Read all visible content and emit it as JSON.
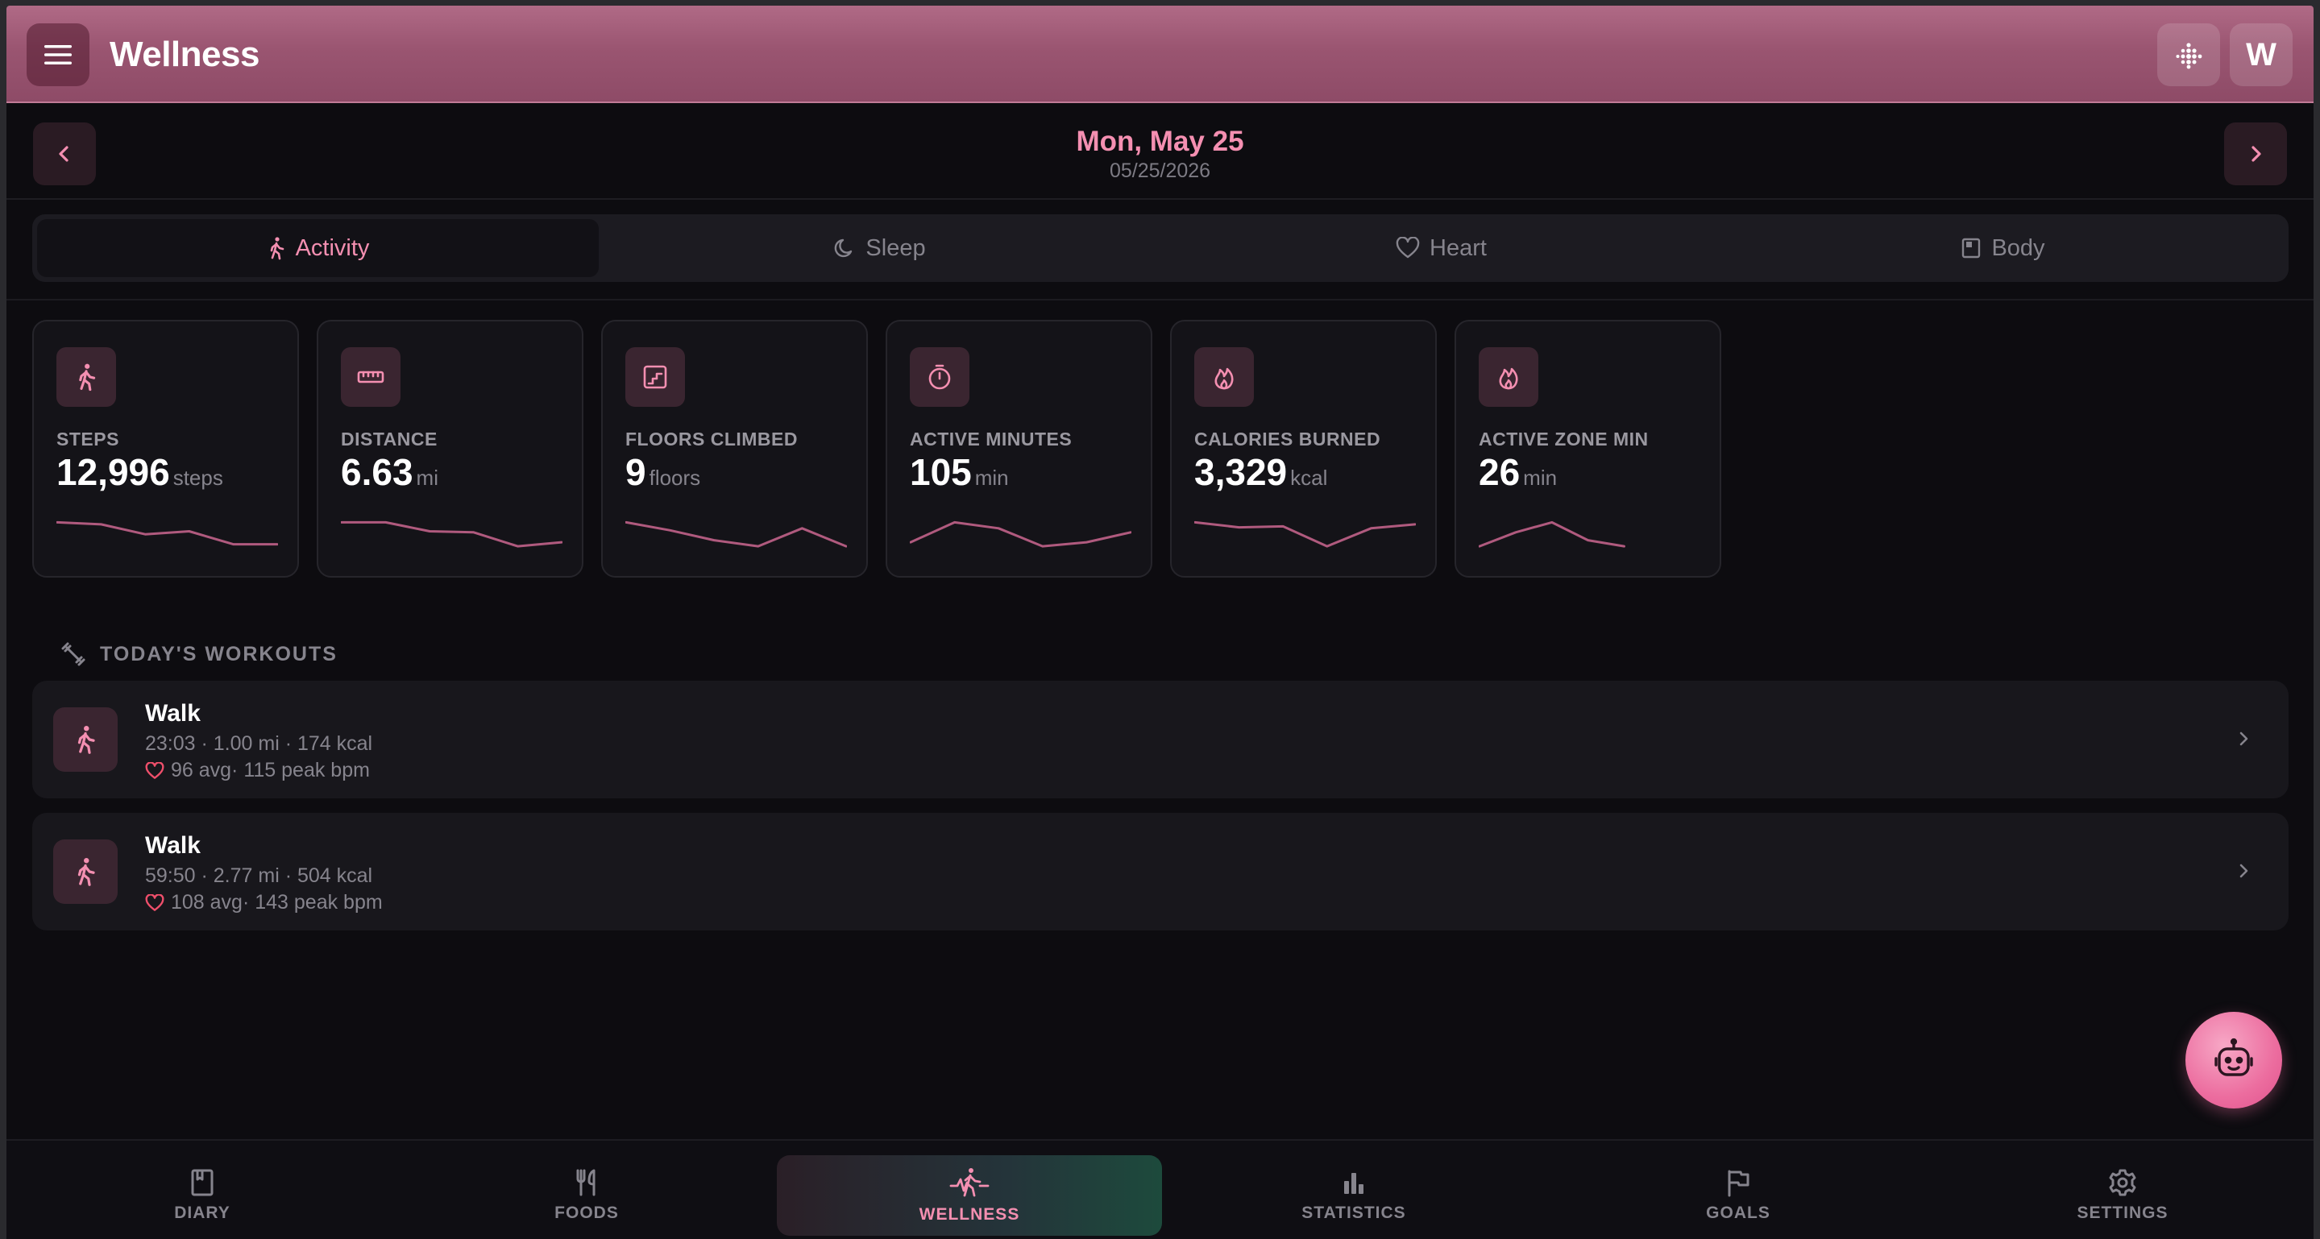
{
  "header": {
    "title": "Wellness",
    "avatar_letter": "W"
  },
  "date": {
    "main": "Mon, May 25",
    "sub": "05/25/2026"
  },
  "tabs": [
    {
      "label": "Activity",
      "icon": "walk-icon",
      "active": true
    },
    {
      "label": "Sleep",
      "icon": "moon-icon",
      "active": false
    },
    {
      "label": "Heart",
      "icon": "heart-icon",
      "active": false
    },
    {
      "label": "Body",
      "icon": "body-icon",
      "active": false
    }
  ],
  "metrics": [
    {
      "label": "STEPS",
      "value": "12,996",
      "unit": "steps",
      "icon": "walk-icon",
      "trend": [
        6,
        8,
        18,
        15,
        28,
        28
      ]
    },
    {
      "label": "DISTANCE",
      "value": "6.63",
      "unit": "mi",
      "icon": "ruler-icon",
      "trend": [
        6,
        6,
        15,
        16,
        30,
        26
      ]
    },
    {
      "label": "FLOORS CLIMBED",
      "value": "9",
      "unit": "floors",
      "icon": "stairs-icon",
      "trend": [
        6,
        14,
        24,
        30,
        12,
        30
      ]
    },
    {
      "label": "ACTIVE MINUTES",
      "value": "105",
      "unit": "min",
      "icon": "stopwatch-icon",
      "trend": [
        26,
        6,
        12,
        30,
        26,
        16
      ]
    },
    {
      "label": "CALORIES BURNED",
      "value": "3,329",
      "unit": "kcal",
      "icon": "flame-icon",
      "trend": [
        6,
        11,
        10,
        30,
        12,
        8
      ]
    },
    {
      "label": "ACTIVE ZONE MIN",
      "value": "26",
      "unit": "min",
      "icon": "flame-icon",
      "trend": [
        30,
        16,
        6,
        24,
        30
      ]
    }
  ],
  "workouts_section": {
    "title": "TODAY'S WORKOUTS"
  },
  "workouts": [
    {
      "name": "Walk",
      "meta": "23:03 · 1.00 mi · 174 kcal",
      "hr": "96 avg· 115 peak bpm"
    },
    {
      "name": "Walk",
      "meta": "59:50 · 2.77 mi · 504 kcal",
      "hr": "108 avg· 143 peak bpm"
    }
  ],
  "bottom_nav": [
    {
      "label": "DIARY",
      "icon": "book-icon",
      "active": false
    },
    {
      "label": "FOODS",
      "icon": "utensils-icon",
      "active": false
    },
    {
      "label": "WELLNESS",
      "icon": "wellness-icon",
      "active": true
    },
    {
      "label": "STATISTICS",
      "icon": "bar-chart-icon",
      "active": false
    },
    {
      "label": "GOALS",
      "icon": "flag-icon",
      "active": false
    },
    {
      "label": "SETTINGS",
      "icon": "gear-icon",
      "active": false
    }
  ],
  "colors": {
    "accent": "#f48fb1",
    "header": "#9a5571",
    "background": "#0d0c10",
    "sparkline": "#b05a7e"
  }
}
